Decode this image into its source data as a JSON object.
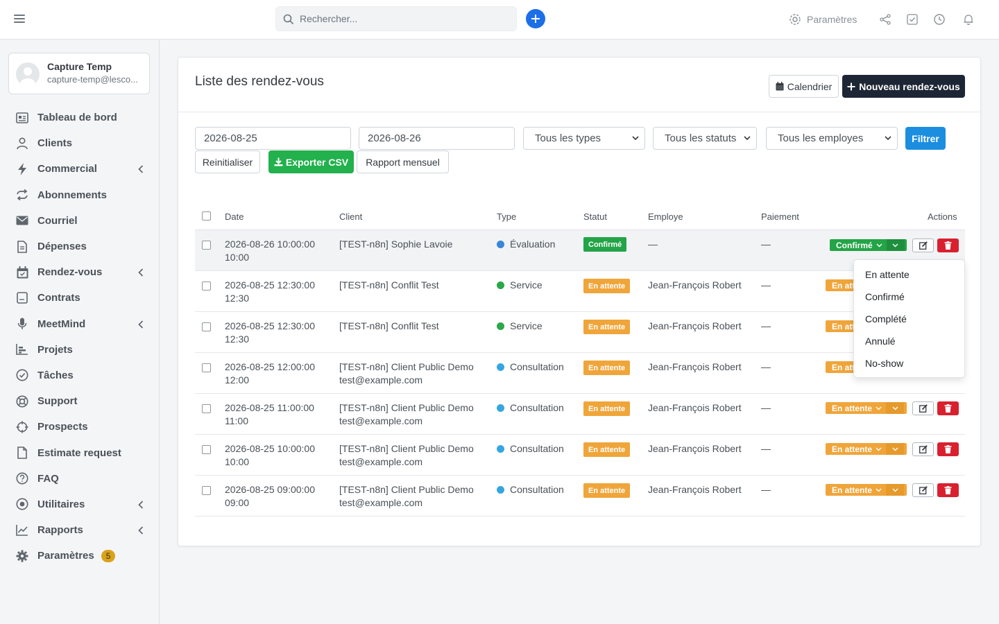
{
  "topbar": {
    "search_placeholder": "Rechercher...",
    "settings_label": "Paramètres"
  },
  "user": {
    "name": "Capture Temp",
    "email": "capture-temp@lesco..."
  },
  "sidebar": {
    "items": [
      {
        "label": "Tableau de bord",
        "icon": "dashboard-icon"
      },
      {
        "label": "Clients",
        "icon": "user-icon"
      },
      {
        "label": "Commercial",
        "icon": "bolt-icon",
        "chevron": true
      },
      {
        "label": "Abonnements",
        "icon": "repeat-icon"
      },
      {
        "label": "Courriel",
        "icon": "envelope-icon"
      },
      {
        "label": "Dépenses",
        "icon": "file-icon"
      },
      {
        "label": "Rendez-vous",
        "icon": "calendar-icon",
        "chevron": true
      },
      {
        "label": "Contrats",
        "icon": "contract-icon"
      },
      {
        "label": "MeetMind",
        "icon": "microphone-icon",
        "chevron": true
      },
      {
        "label": "Projets",
        "icon": "chart-bar-icon"
      },
      {
        "label": "Tâches",
        "icon": "check-circle-icon"
      },
      {
        "label": "Support",
        "icon": "lifebuoy-icon"
      },
      {
        "label": "Prospects",
        "icon": "crosshair-icon"
      },
      {
        "label": "Estimate request",
        "icon": "document-icon"
      },
      {
        "label": "FAQ",
        "icon": "question-icon"
      },
      {
        "label": "Utilitaires",
        "icon": "dot-circle-icon",
        "chevron": true
      },
      {
        "label": "Rapports",
        "icon": "line-chart-icon",
        "chevron": true
      },
      {
        "label": "Paramètres",
        "icon": "gear-icon",
        "badge": "5"
      }
    ]
  },
  "card": {
    "title": "Liste des rendez-vous",
    "calendar_button": "Calendrier",
    "new_button": "Nouveau rendez-vous"
  },
  "filters": {
    "date_from": "2026-08-25",
    "date_to": "2026-08-26",
    "type_select": "Tous les types",
    "status_select": "Tous les statuts",
    "employee_select": "Tous les employes",
    "filter_button": "Filtrer",
    "reset_button": "Reinitialiser",
    "export_button": "Exporter CSV",
    "report_button": "Rapport mensuel"
  },
  "table": {
    "headers": {
      "date": "Date",
      "client": "Client",
      "type": "Type",
      "status": "Statut",
      "employee": "Employe",
      "payment": "Paiement",
      "actions": "Actions"
    },
    "rows": [
      {
        "date": "2026-08-26 10:00:00",
        "time": "10:00",
        "client": "[TEST-n8n] Sophie Lavoie",
        "email": "",
        "type": "Évaluation",
        "type_color": "#3a86d8",
        "status": "Confirmé",
        "status_color": "#23a447",
        "employee": "—",
        "payment": "—",
        "action_status": "Confirmé"
      },
      {
        "date": "2026-08-25 12:30:00",
        "time": "12:30",
        "client": "[TEST-n8n] Conflit Test",
        "email": "",
        "type": "Service",
        "type_color": "#2aa84a",
        "status": "En attente",
        "status_color": "#f0a53a",
        "employee": "Jean-François Robert",
        "payment": "—",
        "action_status": "En att"
      },
      {
        "date": "2026-08-25 12:30:00",
        "time": "12:30",
        "client": "[TEST-n8n] Conflit Test",
        "email": "",
        "type": "Service",
        "type_color": "#2aa84a",
        "status": "En attente",
        "status_color": "#f0a53a",
        "employee": "Jean-François Robert",
        "payment": "—",
        "action_status": "En att"
      },
      {
        "date": "2026-08-25 12:00:00",
        "time": "12:00",
        "client": "[TEST-n8n] Client Public Demo",
        "email": "test@example.com",
        "type": "Consultation",
        "type_color": "#35a6e0",
        "status": "En attente",
        "status_color": "#f0a53a",
        "employee": "Jean-François Robert",
        "payment": "—",
        "action_status": "En att"
      },
      {
        "date": "2026-08-25 11:00:00",
        "time": "11:00",
        "client": "[TEST-n8n] Client Public Demo",
        "email": "test@example.com",
        "type": "Consultation",
        "type_color": "#35a6e0",
        "status": "En attente",
        "status_color": "#f0a53a",
        "employee": "Jean-François Robert",
        "payment": "—",
        "action_status": "En attente"
      },
      {
        "date": "2026-08-25 10:00:00",
        "time": "10:00",
        "client": "[TEST-n8n] Client Public Demo",
        "email": "test@example.com",
        "type": "Consultation",
        "type_color": "#35a6e0",
        "status": "En attente",
        "status_color": "#f0a53a",
        "employee": "Jean-François Robert",
        "payment": "—",
        "action_status": "En attente"
      },
      {
        "date": "2026-08-25 09:00:00",
        "time": "09:00",
        "client": "[TEST-n8n] Client Public Demo",
        "email": "test@example.com",
        "type": "Consultation",
        "type_color": "#35a6e0",
        "status": "En attente",
        "status_color": "#f0a53a",
        "employee": "Jean-François Robert",
        "payment": "—",
        "action_status": "En attente"
      }
    ]
  },
  "status_dropdown": {
    "options": [
      "En attente",
      "Confirmé",
      "Complété",
      "Annulé",
      "No-show"
    ]
  }
}
